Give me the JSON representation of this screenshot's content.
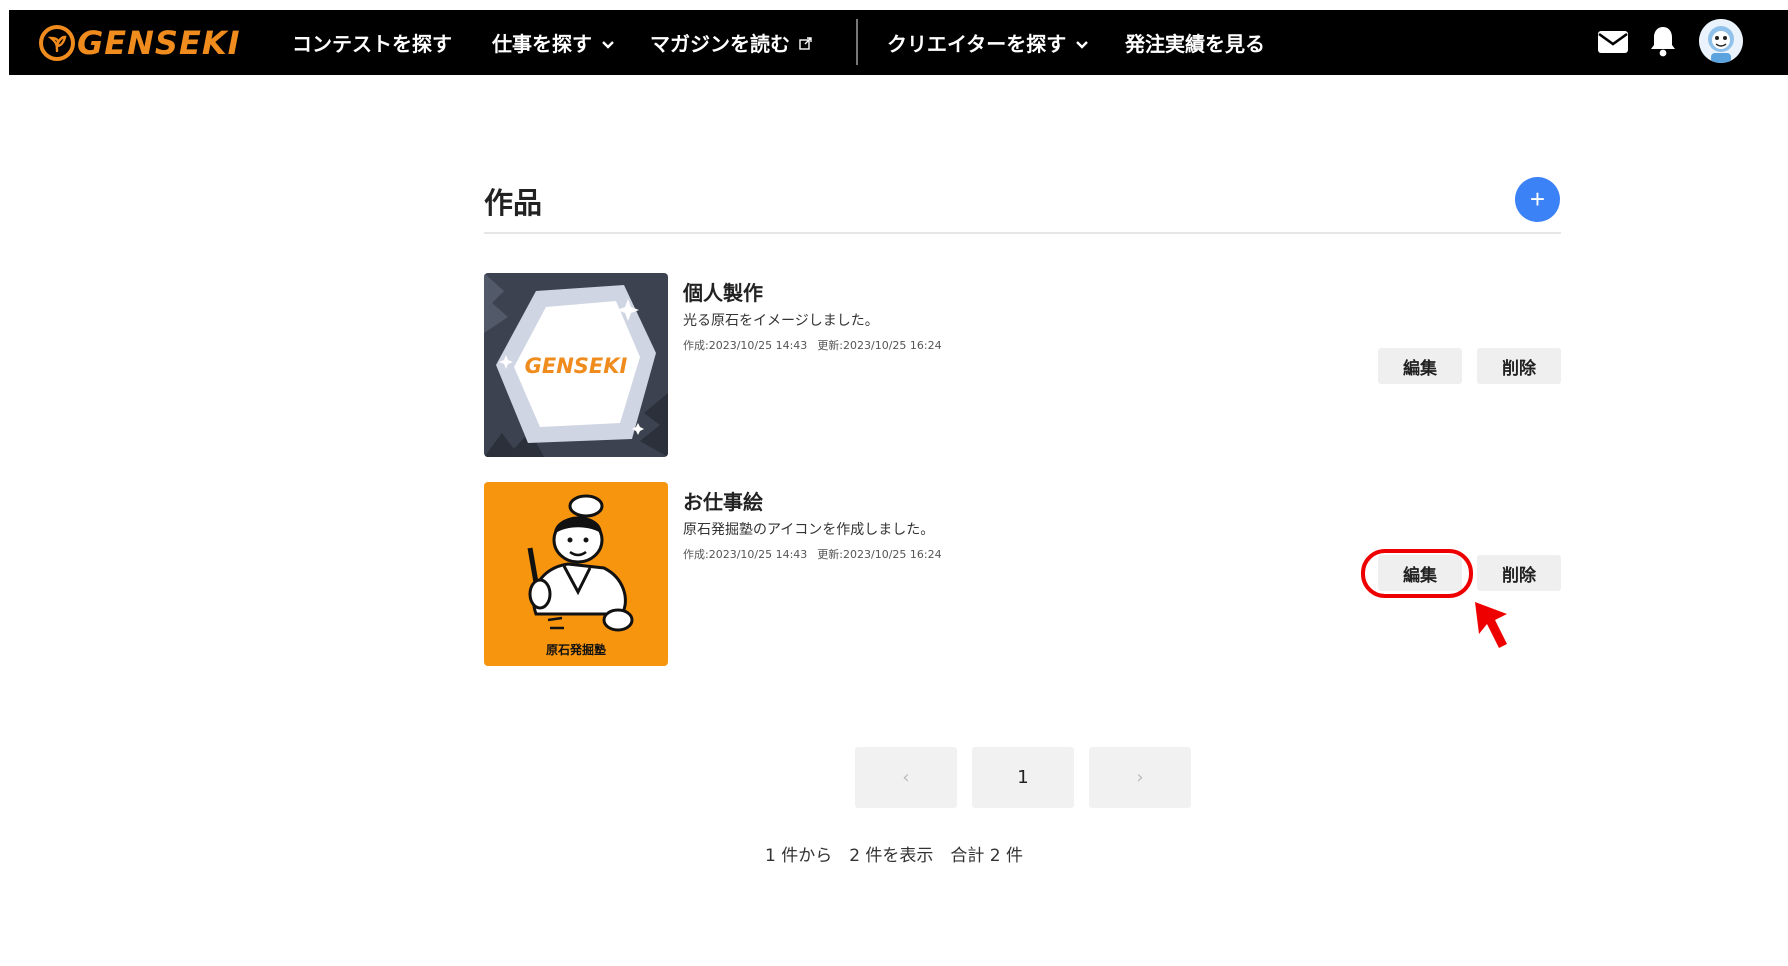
{
  "header": {
    "logo_text": "GENSEKI",
    "nav": [
      {
        "label": "コンテストを探す"
      },
      {
        "label": "仕事を探す"
      },
      {
        "label": "マガジンを読む"
      },
      {
        "label": "クリエイターを探す"
      },
      {
        "label": "発注実績を見る"
      }
    ],
    "icons": [
      "mail-icon",
      "bell-icon",
      "avatar"
    ]
  },
  "main": {
    "section_title": "作品",
    "add_button_label": "+",
    "works": [
      {
        "title": "個人製作",
        "description": "光る原石をイメージしました。",
        "created": "作成:2023/10/25 14:43",
        "updated": "更新:2023/10/25 16:24",
        "thumb_text": "GENSEKI",
        "edit_label": "編集",
        "delete_label": "削除"
      },
      {
        "title": "お仕事絵",
        "description": "原石発掘塾のアイコンを作成しました。",
        "created": "作成:2023/10/25 14:43",
        "updated": "更新:2023/10/25 16:24",
        "thumb_text": "原石発掘塾",
        "edit_label": "編集",
        "delete_label": "削除"
      }
    ]
  },
  "pagination": {
    "prev_label": "‹",
    "current_page": "1",
    "next_label": "›",
    "summary": "1 件から　2 件を表示　合計 2 件"
  },
  "colors": {
    "header_bg": "#000000",
    "brand_orange": "#f08c1e",
    "accent_blue": "#3b82f6",
    "highlight_red": "#ee0000"
  }
}
